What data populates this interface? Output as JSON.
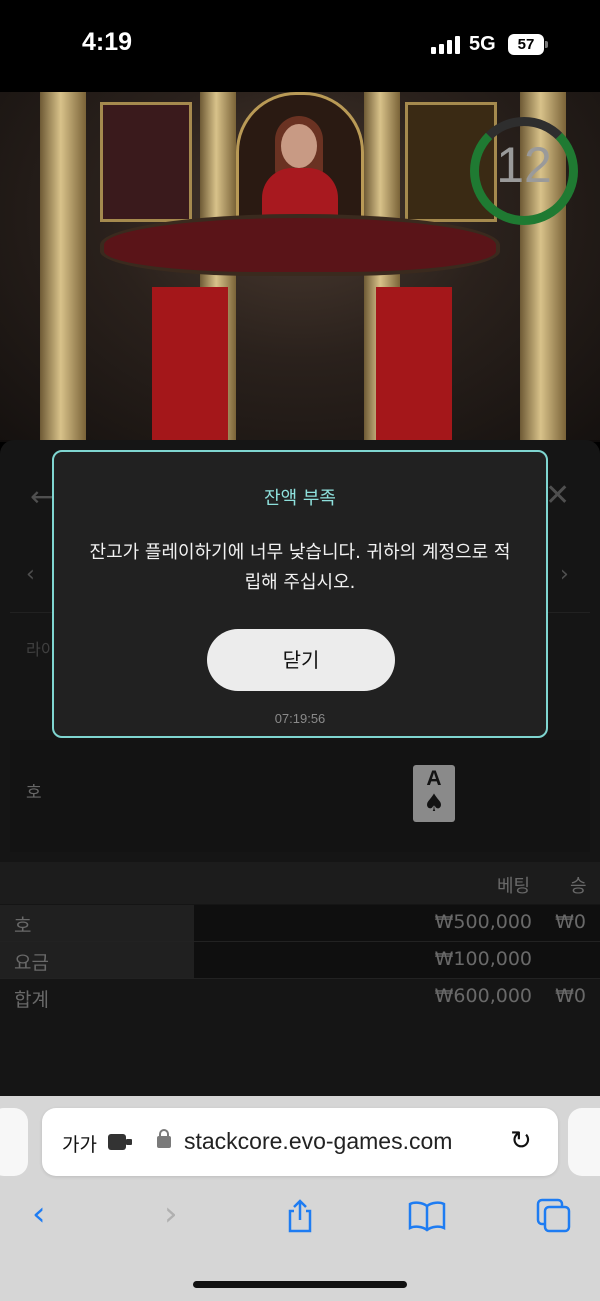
{
  "status_bar": {
    "time": "4:19",
    "network": "5G",
    "battery": "57"
  },
  "video": {
    "countdown": "12",
    "timer_color": "#1f7a32"
  },
  "game_panel": {
    "row_label_partial": "라이",
    "hand_label": "호",
    "card": {
      "rank": "A",
      "suit": "♠"
    }
  },
  "bet_table": {
    "headers": {
      "bet": "베팅",
      "win": "승"
    },
    "rows": [
      {
        "label": "호",
        "bet": "₩500,000",
        "win": "₩0"
      },
      {
        "label": "요금",
        "bet": "₩100,000",
        "win": ""
      },
      {
        "label": "합계",
        "bet": "₩600,000",
        "win": "₩0"
      }
    ]
  },
  "modal": {
    "title": "잔액 부족",
    "message": "잔고가 플레이하기에 너무 낮습니다. 귀하의 계정으로 적립해 주십시오.",
    "button": "닫기",
    "timestamp": "07:19:56",
    "accent_color": "#7fd6d1"
  },
  "browser": {
    "aa_label": "가가",
    "url": "stackcore.evo-games.com",
    "toolbar_icons": [
      "back-icon",
      "forward-icon",
      "share-icon",
      "bookmarks-icon",
      "tabs-icon"
    ]
  }
}
